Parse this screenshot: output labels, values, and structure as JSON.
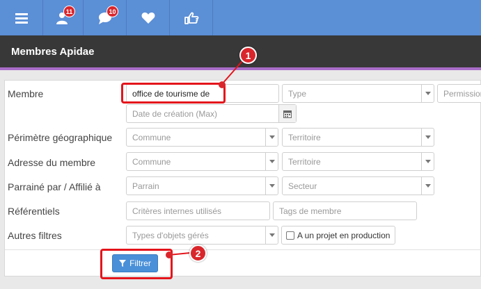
{
  "topbar": {
    "icons": [
      "menu-icon",
      "users-icon",
      "chat-icon",
      "heart-icon",
      "thumbs-up-icon"
    ],
    "users_badge": "11",
    "chat_badge": "10",
    "color": "#5b8fd6"
  },
  "title": "Membres Apidae",
  "form": {
    "membre_label": "Membre",
    "membre_value": "office de tourisme de",
    "type_placeholder": "Type",
    "permission_placeholder": "Permission",
    "date_placeholder": "Date de création (Max)",
    "perimetre_label": "Périmètre géographique",
    "perimetre_commune": "Commune",
    "perimetre_territoire": "Territoire",
    "adresse_label": "Adresse du membre",
    "adresse_commune": "Commune",
    "adresse_territoire": "Territoire",
    "parraine_label": "Parrainé par / Affilié à",
    "parrain_placeholder": "Parrain",
    "secteur_placeholder": "Secteur",
    "referentiels_label": "Référentiels",
    "criteres_placeholder": "Critères internes utilisés",
    "tags_placeholder": "Tags de membre",
    "autres_label": "Autres filtres",
    "types_objets_placeholder": "Types d'objets gérés",
    "projet_label": "A un projet en production",
    "filtrer_label": "Filtrer"
  },
  "annotations": {
    "marker_1": "1",
    "marker_2": "2",
    "color": "#e4141b"
  }
}
